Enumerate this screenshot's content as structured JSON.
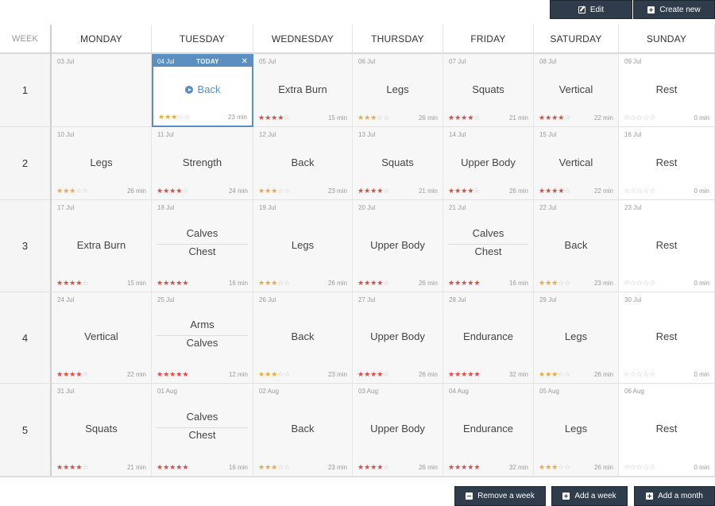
{
  "toolbar": {
    "edit_label": "Edit",
    "create_label": "Create new"
  },
  "footer": {
    "remove_week_label": "Remove a week",
    "add_week_label": "Add a week",
    "add_month_label": "Add a month"
  },
  "colors": {
    "button_bg": "#2f3c4c",
    "today_accent": "#5b8fc2",
    "star_yellow": "#f3a73b",
    "star_red": "#e8473f",
    "star_empty": "#c6c6c6"
  },
  "headers": [
    "WEEK",
    "MONDAY",
    "TUESDAY",
    "WEDNESDAY",
    "THURSDAY",
    "FRIDAY",
    "SATURDAY",
    "SUNDAY"
  ],
  "today_label": "TODAY",
  "weeks": [
    {
      "number": "1",
      "days": [
        {
          "date": "03 Jul",
          "labels": [],
          "stars": 0,
          "star_color": "y",
          "mins": "",
          "empty": true
        },
        {
          "date": "04 Jul",
          "labels": [
            "Back"
          ],
          "stars": 3,
          "star_color": "y",
          "mins": "23 min",
          "today": true
        },
        {
          "date": "05 Jul",
          "labels": [
            "Extra Burn"
          ],
          "stars": 4,
          "star_color": "r",
          "mins": "15 min"
        },
        {
          "date": "06 Jul",
          "labels": [
            "Legs"
          ],
          "stars": 3,
          "star_color": "y",
          "mins": "26 min"
        },
        {
          "date": "07 Jul",
          "labels": [
            "Squats"
          ],
          "stars": 4,
          "star_color": "r",
          "mins": "21 min"
        },
        {
          "date": "08 Jul",
          "labels": [
            "Vertical"
          ],
          "stars": 4,
          "star_color": "r",
          "mins": "22 min"
        },
        {
          "date": "09 Jul",
          "labels": [
            "Rest"
          ],
          "stars": 0,
          "star_color": "y",
          "mins": "0 min",
          "rest": true
        }
      ]
    },
    {
      "number": "2",
      "days": [
        {
          "date": "10 Jul",
          "labels": [
            "Legs"
          ],
          "stars": 3,
          "star_color": "y",
          "mins": "26 min"
        },
        {
          "date": "11 Jul",
          "labels": [
            "Strength"
          ],
          "stars": 4,
          "star_color": "r",
          "mins": "24 min"
        },
        {
          "date": "12 Jul",
          "labels": [
            "Back"
          ],
          "stars": 3,
          "star_color": "y",
          "mins": "23 min"
        },
        {
          "date": "13 Jul",
          "labels": [
            "Squats"
          ],
          "stars": 4,
          "star_color": "r",
          "mins": "21 min"
        },
        {
          "date": "14 Jul",
          "labels": [
            "Upper Body"
          ],
          "stars": 4,
          "star_color": "r",
          "mins": "26 min"
        },
        {
          "date": "15 Jul",
          "labels": [
            "Vertical"
          ],
          "stars": 4,
          "star_color": "r",
          "mins": "22 min"
        },
        {
          "date": "16 Jul",
          "labels": [
            "Rest"
          ],
          "stars": 0,
          "star_color": "y",
          "mins": "0 min",
          "rest": true
        }
      ]
    },
    {
      "number": "3",
      "days": [
        {
          "date": "17 Jul",
          "labels": [
            "Extra Burn"
          ],
          "stars": 4,
          "star_color": "r",
          "mins": "15 min"
        },
        {
          "date": "18 Jul",
          "labels": [
            "Calves",
            "Chest"
          ],
          "stars": 5,
          "star_color": "r",
          "mins": "16 min"
        },
        {
          "date": "19 Jul",
          "labels": [
            "Legs"
          ],
          "stars": 3,
          "star_color": "y",
          "mins": "26 min"
        },
        {
          "date": "20 Jul",
          "labels": [
            "Upper Body"
          ],
          "stars": 4,
          "star_color": "r",
          "mins": "26 min"
        },
        {
          "date": "21 Jul",
          "labels": [
            "Calves",
            "Chest"
          ],
          "stars": 5,
          "star_color": "r",
          "mins": "16 min"
        },
        {
          "date": "22 Jul",
          "labels": [
            "Back"
          ],
          "stars": 3,
          "star_color": "y",
          "mins": "23 min"
        },
        {
          "date": "23 Jul",
          "labels": [
            "Rest"
          ],
          "stars": 0,
          "star_color": "y",
          "mins": "0 min",
          "rest": true
        }
      ]
    },
    {
      "number": "4",
      "days": [
        {
          "date": "24 Jul",
          "labels": [
            "Vertical"
          ],
          "stars": 4,
          "star_color": "r",
          "mins": "22 min"
        },
        {
          "date": "25 Jul",
          "labels": [
            "Arms",
            "Calves"
          ],
          "stars": 5,
          "star_color": "r",
          "mins": "12 min"
        },
        {
          "date": "26 Jul",
          "labels": [
            "Back"
          ],
          "stars": 3,
          "star_color": "y",
          "mins": "23 min"
        },
        {
          "date": "27 Jul",
          "labels": [
            "Upper Body"
          ],
          "stars": 4,
          "star_color": "r",
          "mins": "26 min"
        },
        {
          "date": "28 Jul",
          "labels": [
            "Endurance"
          ],
          "stars": 5,
          "star_color": "r",
          "mins": "32 min"
        },
        {
          "date": "29 Jul",
          "labels": [
            "Legs"
          ],
          "stars": 3,
          "star_color": "y",
          "mins": "26 min"
        },
        {
          "date": "30 Jul",
          "labels": [
            "Rest"
          ],
          "stars": 0,
          "star_color": "y",
          "mins": "0 min",
          "rest": true
        }
      ]
    },
    {
      "number": "5",
      "days": [
        {
          "date": "31 Jul",
          "labels": [
            "Squats"
          ],
          "stars": 4,
          "star_color": "r",
          "mins": "21 min"
        },
        {
          "date": "01 Aug",
          "labels": [
            "Calves",
            "Chest"
          ],
          "stars": 5,
          "star_color": "r",
          "mins": "16 min"
        },
        {
          "date": "02 Aug",
          "labels": [
            "Back"
          ],
          "stars": 3,
          "star_color": "y",
          "mins": "23 min"
        },
        {
          "date": "03 Aug",
          "labels": [
            "Upper Body"
          ],
          "stars": 4,
          "star_color": "r",
          "mins": "26 min"
        },
        {
          "date": "04 Aug",
          "labels": [
            "Endurance"
          ],
          "stars": 5,
          "star_color": "r",
          "mins": "32 min"
        },
        {
          "date": "05 Aug",
          "labels": [
            "Legs"
          ],
          "stars": 3,
          "star_color": "y",
          "mins": "26 min"
        },
        {
          "date": "06 Aug",
          "labels": [
            "Rest"
          ],
          "stars": 0,
          "star_color": "y",
          "mins": "0 min",
          "rest": true
        }
      ]
    }
  ]
}
